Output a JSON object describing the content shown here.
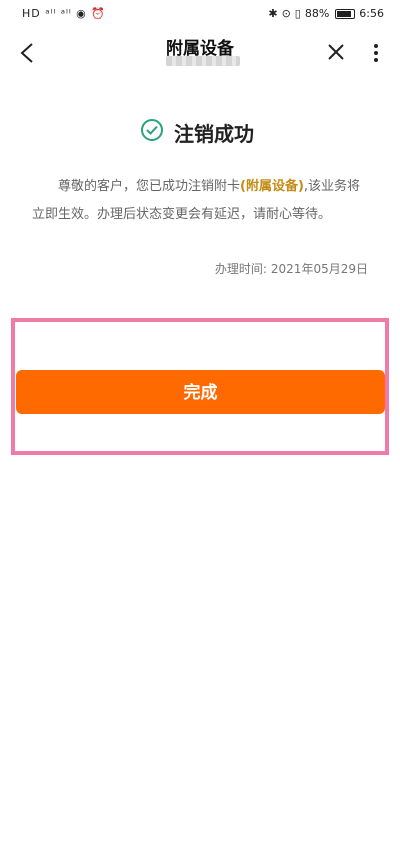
{
  "status_bar": {
    "left_indicators": "HD  ᵃˡˡ  ᵃˡˡ  ◉  ⏰",
    "bluetooth": "✱",
    "location": "⊙",
    "vibrate": "▯",
    "battery_percent": "88%",
    "battery_level": 0.88,
    "time": "6:56"
  },
  "nav": {
    "title": "附属设备"
  },
  "result": {
    "title": "注销成功"
  },
  "message": {
    "part1": "尊敬的客户，您已成功注销附卡",
    "highlight": "(附属设备)",
    "part2": ",该业务将立即生效。办理后状态变更会有延迟，请耐心等待。"
  },
  "time": {
    "label": "办理时间:",
    "value": "2021年05月29日"
  },
  "actions": {
    "done_label": "完成"
  },
  "colors": {
    "accent": "#ff6a00",
    "success": "#2aa37a",
    "highlight": "#c58b15",
    "frame": "#f07bab"
  }
}
